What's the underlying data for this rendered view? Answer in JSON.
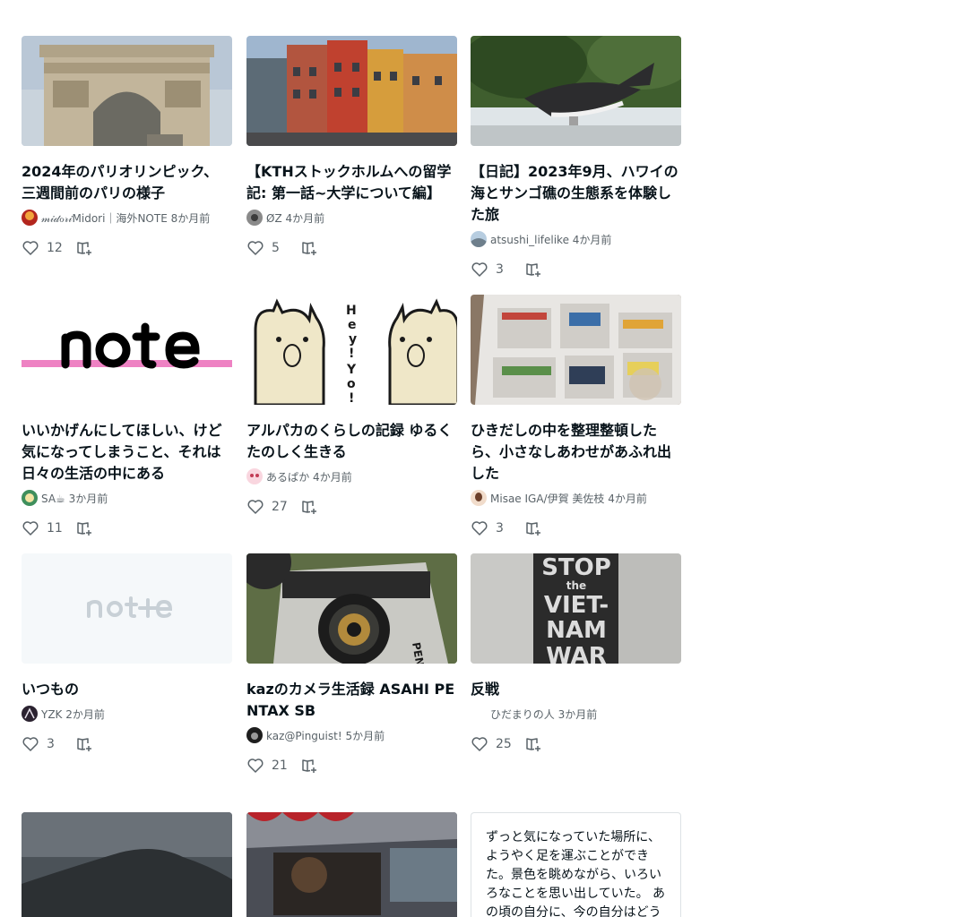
{
  "cards": [
    {
      "title": "2024年のパリオリンピック、三週間前のパリの様子",
      "author": "𝓂𝒾𝒹ℴ𝓇𝒾Midori｜海外NOTE 8か月前",
      "likes": "12"
    },
    {
      "title": "【KTHストックホルムへの留学記: 第一話~大学について編】",
      "author": "ØZ 4か月前",
      "likes": "5"
    },
    {
      "title": "【日記】2023年9月、ハワイの海とサンゴ礁の生態系を体験した旅",
      "author": "atsushi_lifelike 4か月前",
      "likes": "3"
    },
    {
      "title": "いいかげんにしてほしい、けど気になってしまうこと、それは日々の生活の中にある",
      "author": "SA☕ 3か月前",
      "likes": "11"
    },
    {
      "title": "アルパカのくらしの記録 ゆるくたのしく生きる",
      "author": "あるぱか 4か月前",
      "likes": "27"
    },
    {
      "title": "ひきだしの中を整理整頓したら、小さなしあわせがあふれ出した",
      "author": "Misae IGA/伊賀 美佐枝 4か月前",
      "likes": "3"
    },
    {
      "title": "いつもの",
      "author": "YZK 2か月前",
      "likes": "3"
    },
    {
      "title": "kazのカメラ生活録 ASAHI PENTAX SB",
      "author": "kaz@Pinguist! 5か月前",
      "likes": "21"
    },
    {
      "title": "反戦",
      "author": "ひだまりの人 3か月前",
      "likes": "25"
    }
  ],
  "text_card": {
    "body": "ずっと気になっていた場所に、ようやく足を運ぶことができた。景色を眺めながら、いろいろなことを思い出していた。 あの頃の自分に、今の自分はどう見えているのだろうか。答えはまだ見つからないけれど、それでいいと思えた."
  },
  "colors": {
    "accent": "#08131a",
    "muted": "#5a6369",
    "icon": "#5a6369",
    "note_pink": "#ee82c3"
  }
}
